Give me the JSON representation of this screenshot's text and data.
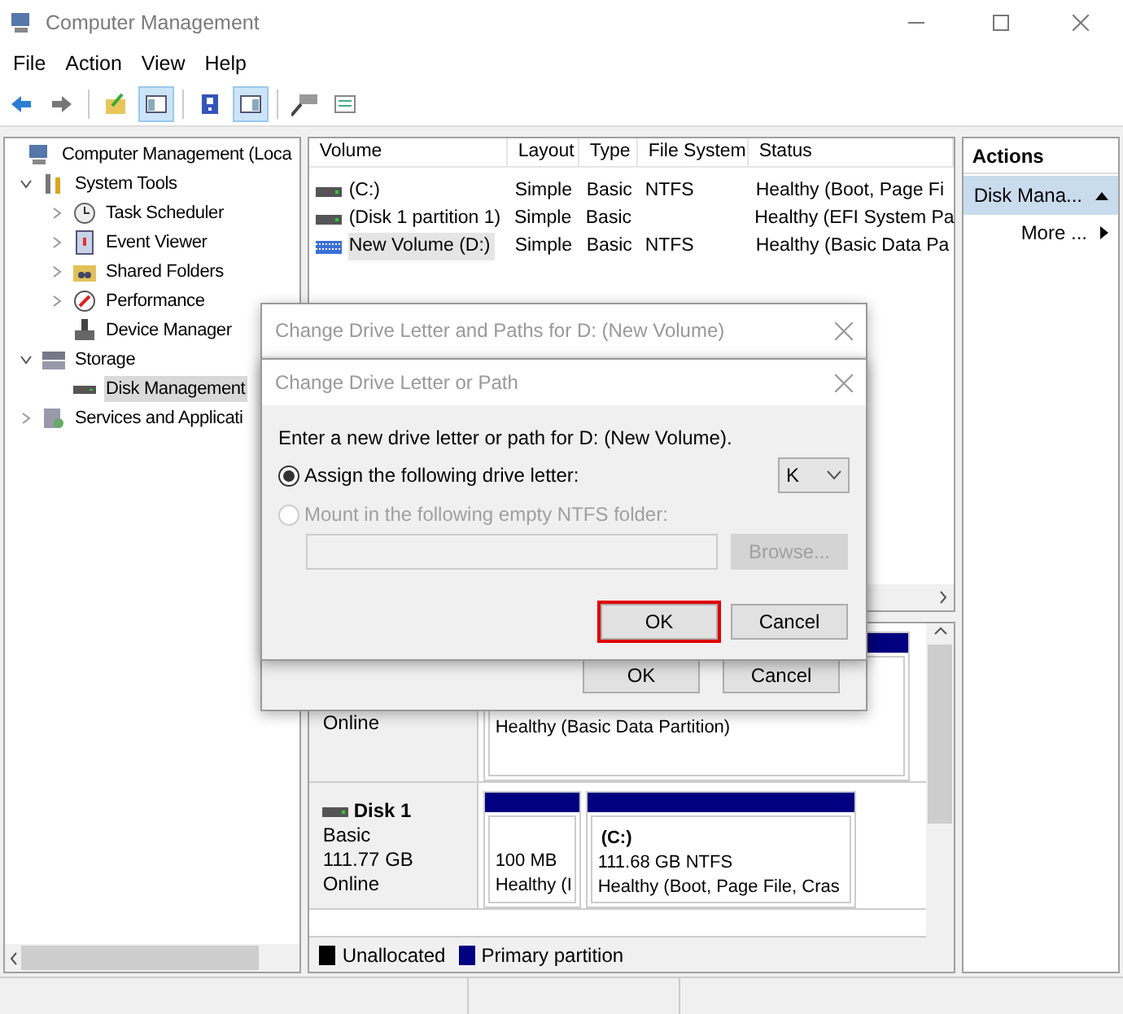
{
  "window": {
    "title": "Computer Management"
  },
  "menu": [
    "File",
    "Action",
    "View",
    "Help"
  ],
  "toolbar": [
    {
      "pressed": false
    },
    {
      "pressed": false
    },
    {
      "pressed": false
    },
    {
      "pressed": true
    },
    {
      "pressed": false
    },
    {
      "pressed": true
    },
    {
      "pressed": false
    },
    {
      "pressed": false
    }
  ],
  "tree": {
    "label": "Computer Management (Loca",
    "selected": false,
    "children": [
      {
        "label": "System Tools",
        "expanded": true,
        "selected": false,
        "children": [
          {
            "label": "Task Scheduler",
            "expanded": false,
            "selected": false
          },
          {
            "label": "Event Viewer",
            "expanded": false,
            "selected": false
          },
          {
            "label": "Shared Folders",
            "expanded": false,
            "selected": false
          },
          {
            "label": "Performance",
            "expanded": false,
            "selected": false
          },
          {
            "label": "Device Manager",
            "selected": false
          }
        ]
      },
      {
        "label": "Storage",
        "expanded": true,
        "selected": false,
        "children": [
          {
            "label": "Disk Management",
            "selected": true
          }
        ]
      },
      {
        "label": "Services and Applicati",
        "expanded": false,
        "selected": false
      }
    ]
  },
  "volumes": {
    "columns": [
      "Volume",
      "Layout",
      "Type",
      "File System",
      "Status"
    ],
    "rows": [
      {
        "cells": [
          "(C:)",
          "Simple",
          "Basic",
          "NTFS",
          "Healthy (Boot, Page Fi"
        ],
        "selected": false
      },
      {
        "cells": [
          "(Disk 1 partition 1)",
          "Simple",
          "Basic",
          "",
          "Healthy (EFI System Pa"
        ],
        "selected": false
      },
      {
        "cells": [
          "New Volume (D:)",
          "Simple",
          "Basic",
          "NTFS",
          "Healthy (Basic Data Pa"
        ],
        "selected": true
      }
    ]
  },
  "disks": [
    {
      "lines": [
        "Online"
      ],
      "partitions": [
        {
          "lines": [
            "Healthy (Basic Data Partition)"
          ]
        }
      ]
    },
    {
      "name": "Disk 1",
      "lines": [
        "Basic",
        "111.77 GB",
        "Online"
      ],
      "partitions": [
        {
          "lines": [
            "100 MB",
            "Healthy (I"
          ]
        },
        {
          "label": "(C:)",
          "lines": [
            "111.68 GB NTFS",
            "Healthy (Boot, Page File, Cras"
          ]
        }
      ]
    }
  ],
  "legend": [
    {
      "label": "Unallocated",
      "color": "#000000"
    },
    {
      "label": "Primary partition",
      "color": "#000080"
    }
  ],
  "actions": {
    "title": "Actions",
    "items": [
      {
        "label": "Disk Mana...",
        "kind": "header"
      },
      {
        "label": "More ...",
        "kind": "submenu"
      }
    ]
  },
  "outer_dialog": {
    "title": "Change Drive Letter and Paths for D: (New Volume)",
    "buttons": [
      "OK",
      "Cancel"
    ]
  },
  "inner_dialog": {
    "title": "Change Drive Letter or Path",
    "prompt": "Enter a new drive letter or path for D: (New Volume).",
    "options": [
      {
        "label": "Assign the following drive letter:",
        "selected": true,
        "disabled": false
      },
      {
        "label": "Mount in the following empty NTFS folder:",
        "selected": false,
        "disabled": true
      }
    ],
    "drive_letter": "K",
    "browse": {
      "label": "Browse...",
      "disabled": true
    },
    "buttons": [
      {
        "label": "OK",
        "highlighted": true
      },
      {
        "label": "Cancel",
        "highlighted": false
      }
    ]
  }
}
